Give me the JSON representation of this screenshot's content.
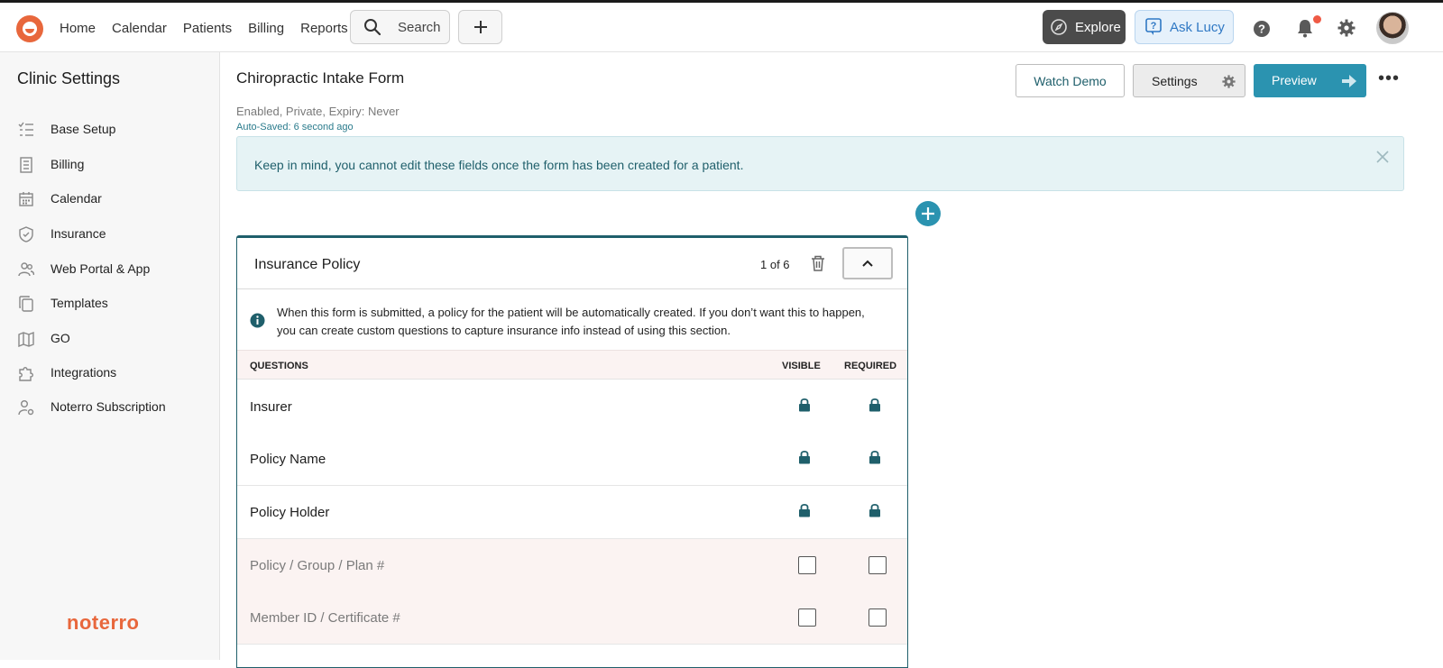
{
  "topnav": {
    "items": [
      "Home",
      "Calendar",
      "Patients",
      "Billing",
      "Reports"
    ],
    "search_label": "Search",
    "explore_label": "Explore",
    "ask_lucy_label": "Ask Lucy"
  },
  "sidebar": {
    "title": "Clinic Settings",
    "items": [
      {
        "label": "Base Setup",
        "icon": "list-check-icon"
      },
      {
        "label": "Billing",
        "icon": "receipt-icon"
      },
      {
        "label": "Calendar",
        "icon": "calendar-icon"
      },
      {
        "label": "Insurance",
        "icon": "shield-icon"
      },
      {
        "label": "Web Portal & App",
        "icon": "users-icon"
      },
      {
        "label": "Templates",
        "icon": "copy-icon"
      },
      {
        "label": "GO",
        "icon": "map-icon"
      },
      {
        "label": "Integrations",
        "icon": "puzzle-icon"
      },
      {
        "label": "Noterro Subscription",
        "icon": "user-gear-icon"
      }
    ],
    "brand": "noterro"
  },
  "form": {
    "title": "Chiropractic Intake Form",
    "meta": "Enabled, Private, Expiry: Never",
    "autosave": "Auto-Saved: 6 second ago",
    "watch_demo": "Watch Demo",
    "settings": "Settings",
    "preview": "Preview"
  },
  "banner": {
    "text": "Keep in mind, you cannot edit these fields once the form has been created for a patient."
  },
  "section": {
    "title": "Insurance Policy",
    "count": "1 of 6",
    "info": "When this form is submitted, a policy for the patient will be automatically created. If you don’t want this to happen, you can create custom questions to capture insurance info instead of using this section.",
    "columns": {
      "questions": "QUESTIONS",
      "visible": "VISIBLE",
      "required": "REQUIRED"
    },
    "rows": [
      {
        "label": "Insurer",
        "visible": "locked",
        "required": "locked"
      },
      {
        "label": "Policy Name",
        "visible": "locked",
        "required": "locked"
      },
      {
        "label": "Policy Holder",
        "visible": "locked",
        "required": "locked"
      },
      {
        "label": "Policy / Group / Plan #",
        "visible": false,
        "required": false
      },
      {
        "label": "Member ID / Certificate #",
        "visible": false,
        "required": false
      }
    ]
  },
  "colors": {
    "brand": "#e8673c",
    "accent": "#2b93b0",
    "teal_dark": "#1f5f6b",
    "notification": "#ef5a45"
  }
}
